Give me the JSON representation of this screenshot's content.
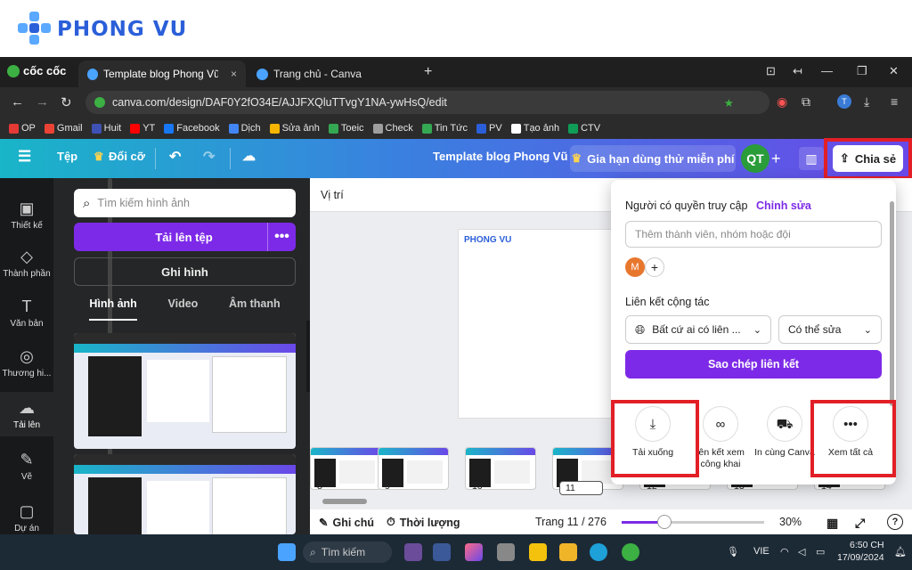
{
  "watermark": {
    "brand": "PHONG VU"
  },
  "browser": {
    "brand": "cốc cốc",
    "tabs": [
      {
        "label": "Template blog Phong Vũ - 14",
        "close": "×"
      },
      {
        "label": "Trang chủ - Canva"
      }
    ],
    "new_tab": "+",
    "url": "canva.com/design/DAF0Y2fO34E/AJJFXQluTTvgY1NA-ywHsQ/edit",
    "bookmarks": [
      {
        "label": "OP",
        "color": "#e53935"
      },
      {
        "label": "Gmail",
        "color": "#ea4335"
      },
      {
        "label": "Huit",
        "color": "#3f51b5"
      },
      {
        "label": "YT",
        "color": "#ff0000"
      },
      {
        "label": "Facebook",
        "color": "#1877f2"
      },
      {
        "label": "Dịch",
        "color": "#4285f4"
      },
      {
        "label": "Sửa ảnh",
        "color": "#f4b400"
      },
      {
        "label": "Toeic",
        "color": "#34a853"
      },
      {
        "label": "Check",
        "color": "#9e9e9e"
      },
      {
        "label": "Tin Tức",
        "color": "#34a853"
      },
      {
        "label": "PV",
        "color": "#2b5fd9"
      },
      {
        "label": "Tạo ảnh",
        "color": "#ffffff"
      },
      {
        "label": "CTV",
        "color": "#0f9d58"
      }
    ]
  },
  "canva_top": {
    "file": "Tệp",
    "resize": "Đổi cỡ",
    "title": "Template blog Phong Vũ",
    "trial": "Gia hạn dùng thử miễn phí",
    "avatar": "QT",
    "share": "Chia sẻ"
  },
  "rail": [
    {
      "label": "Thiết kế",
      "icon": "▣"
    },
    {
      "label": "Thành phần",
      "icon": "◇"
    },
    {
      "label": "Văn bản",
      "icon": "T"
    },
    {
      "label": "Thương hi...",
      "icon": "◎"
    },
    {
      "label": "Tải lên",
      "icon": "☁"
    },
    {
      "label": "Vẽ",
      "icon": "✎"
    },
    {
      "label": "Dự án",
      "icon": "▢"
    }
  ],
  "panel": {
    "search_placeholder": "Tìm kiếm hình ảnh",
    "upload": "Tải lên tệp",
    "more": "•••",
    "record": "Ghi hình",
    "tabs": [
      "Hình ảnh",
      "Video",
      "Âm thanh"
    ]
  },
  "workspace": {
    "position": "Vị trí",
    "page_logo": "PHONG VU",
    "slides": [
      "8",
      "9",
      "10",
      "11",
      "12",
      "13",
      "14"
    ],
    "notes": "Ghi chú",
    "duration": "Thời lượng",
    "page": "Trang 11 / 276",
    "zoom": "30%",
    "zoom_level": 0.3,
    "help": "?"
  },
  "share_popup": {
    "access_label": "Người có quyền truy cập",
    "edit": "Chỉnh sửa",
    "member_placeholder": "Thêm thành viên, nhóm hoặc đội",
    "member_initial": "M",
    "collab_label": "Liên kết cộng tác",
    "anyone": "Bất cứ ai có liên ...",
    "permission": "Có thể sửa",
    "copy": "Sao chép liên kết",
    "options": [
      {
        "label": "Tải xuống",
        "icon": "download-icon"
      },
      {
        "label": "iên kết xem công khai",
        "icon": "link-icon"
      },
      {
        "label": "In cùng Canva",
        "icon": "truck-icon"
      },
      {
        "label": "Xem tất cả",
        "icon": "more-icon"
      }
    ]
  },
  "taskbar": {
    "search": "Tìm kiếm",
    "lang": "VIE",
    "time": "6:50 CH",
    "date": "17/09/2024"
  },
  "colors": {
    "accent": "#7d2ae8",
    "highlight": "#e21f26"
  }
}
